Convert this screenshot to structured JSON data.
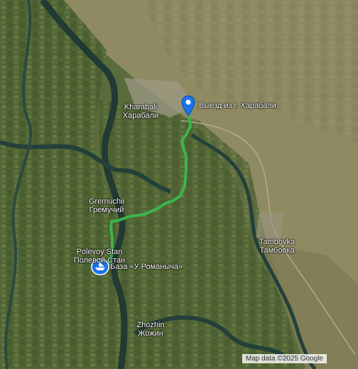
{
  "places": [
    {
      "id": "kharabali",
      "line1": "Kharabali",
      "line2": "Харабали"
    },
    {
      "id": "gremuchii",
      "line1": "Gremuchii",
      "line2": "Гремучий"
    },
    {
      "id": "polevoy",
      "line1": "Polevoy Stan",
      "line2": "Полевой Стан"
    },
    {
      "id": "tambovka",
      "line1": "Tambovka",
      "line2": "Тамбовка"
    },
    {
      "id": "zhozhin",
      "line1": "Zhozhin",
      "line2": "Жожин"
    }
  ],
  "markers": {
    "start": {
      "label": "Выезд из г. Харабали",
      "icon": "map-pin-icon",
      "color": "#1a73e8"
    },
    "end": {
      "label": "База «У Романыча»",
      "icon": "boat-icon",
      "color": "#1a73e8"
    }
  },
  "route": {
    "color": "#3cb54a"
  },
  "attribution": "Map data ©2025 Google"
}
